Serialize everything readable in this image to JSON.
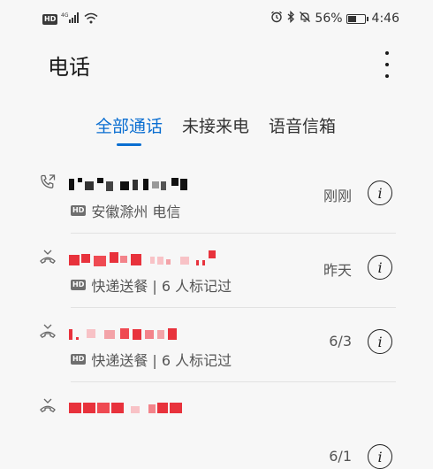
{
  "status_bar": {
    "hd": "HD",
    "network": "4G",
    "battery": "56%",
    "battery_level": 0.56,
    "time": "4:46"
  },
  "app_title": "电话",
  "tabs": [
    {
      "label": "全部通话",
      "active": true
    },
    {
      "label": "未接来电",
      "active": false
    },
    {
      "label": "语音信箱",
      "active": false
    }
  ],
  "calls": [
    {
      "type": "outgoing",
      "number_masked": true,
      "hd": "HD",
      "subtitle": "安徽滁州 电信",
      "time": "刚刚",
      "number_color": "#111111"
    },
    {
      "type": "missed",
      "number_masked": true,
      "hd": "HD",
      "subtitle": "快递送餐 | 6 人标记过",
      "time": "昨天",
      "number_color": "#e8323c"
    },
    {
      "type": "missed",
      "number_masked": true,
      "hd": "HD",
      "subtitle": "快递送餐 | 6 人标记过",
      "time": "6/3",
      "number_color": "#e8323c"
    },
    {
      "type": "missed",
      "number_masked": true,
      "hd": "HD",
      "subtitle": "",
      "time": "6/1",
      "number_color": "#e8323c"
    }
  ],
  "colors": {
    "accent": "#0a6ed1",
    "missed": "#e8323c",
    "text": "#1a1a1a",
    "background": "#f7f7f7"
  }
}
